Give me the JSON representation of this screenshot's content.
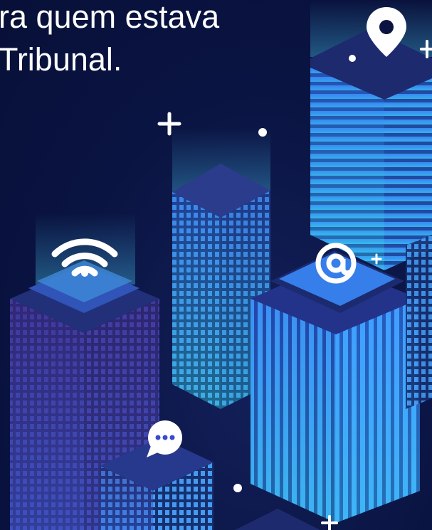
{
  "headline": {
    "line1": "ra quem estava",
    "line2": "Tribunal."
  },
  "icons": {
    "wifi": "wifi-icon",
    "location": "location-pin-icon",
    "at": "at-sign-icon",
    "chat": "chat-bubble-icon",
    "plus": "plus-icon"
  },
  "colors": {
    "background": "#0a1442",
    "building_cyan": "#3fe0d6",
    "building_blue": "#3a7bff",
    "building_purple": "#4a2a8a",
    "icon_white": "#ffffff"
  }
}
